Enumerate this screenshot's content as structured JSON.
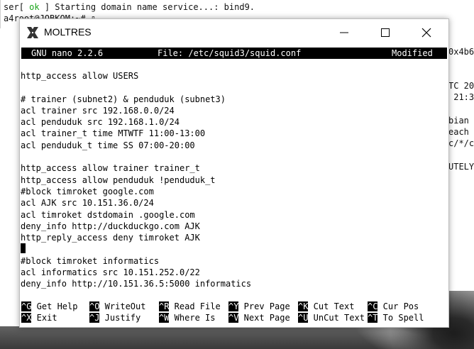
{
  "background_terminal": {
    "line1_prefix": "ser",
    "line1_bracket_open": "[ ",
    "line1_ok": "ok",
    "line1_rest": " ] Starting domain name service...: bind9.",
    "line2": "a4",
    "line2_cut": "root@JOBKOM:~# ▯",
    "side_lines": [
      "0x4b6",
      "",
      "",
      "TC 20",
      " 21:3",
      "",
      "bian",
      "each",
      "c/*/c",
      "",
      "UTELY"
    ]
  },
  "window": {
    "title": "MOLTRES",
    "minimize_label": "minimize",
    "maximize_label": "maximize",
    "close_label": "close"
  },
  "nano": {
    "version": "GNU nano 2.2.6",
    "file": "File: /etc/squid3/squid.conf",
    "status": "Modified",
    "lines": [
      "http_access allow USERS",
      "",
      "# trainer (subnet2) & penduduk (subnet3)",
      "acl trainer src 192.168.0.0/24",
      "acl penduduk src 192.168.1.0/24",
      "acl trainer_t time MTWTF 11:00-13:00",
      "acl penduduk_t time SS 07:00-20:00",
      "",
      "http_access allow trainer trainer_t",
      "http_access allow penduduk !penduduk_t",
      "#block timroket google.com",
      "acl AJK src 10.151.36.0/24",
      "acl timroket dstdomain .google.com",
      "deny_info http://duckduckgo.com AJK",
      "http_reply_access deny timroket AJK",
      "",
      "#block timroket informatics",
      "acl informatics src 10.151.252.0/22",
      "deny_info http://10.151.36.5:5000 informatics"
    ],
    "shortcuts_row1": [
      {
        "key": "^G",
        "label": " Get Help"
      },
      {
        "key": "^O",
        "label": " WriteOut"
      },
      {
        "key": "^R",
        "label": " Read File"
      },
      {
        "key": "^Y",
        "label": " Prev Page"
      },
      {
        "key": "^K",
        "label": " Cut Text"
      },
      {
        "key": "^C",
        "label": " Cur Pos"
      }
    ],
    "shortcuts_row2": [
      {
        "key": "^X",
        "label": " Exit"
      },
      {
        "key": "^J",
        "label": " Justify"
      },
      {
        "key": "^W",
        "label": " Where Is"
      },
      {
        "key": "^V",
        "label": " Next Page"
      },
      {
        "key": "^U",
        "label": " UnCut Text"
      },
      {
        "key": "^T",
        "label": " To Spell"
      }
    ]
  },
  "colors": {
    "ok_green": "#1aa51a",
    "terminal_bg": "#ffffff",
    "inverse_bg": "#000000"
  },
  "icons": {
    "app": "x-logo-icon",
    "minimize": "minimize-icon",
    "maximize": "maximize-icon",
    "close": "close-icon"
  }
}
